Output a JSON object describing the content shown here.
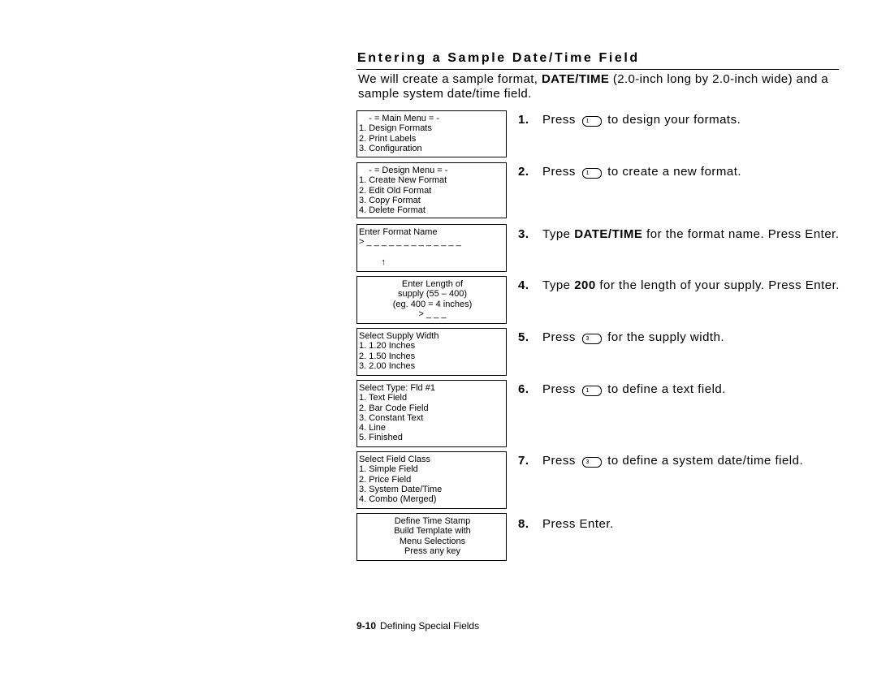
{
  "title": "Entering a Sample Date/Time Field",
  "intro": {
    "pre": "We will create a sample format, ",
    "bold": "DATE/TIME",
    "post": " (2.0-inch long by 2.0-inch wide) and a sample system date/time field."
  },
  "screens": [
    {
      "lines": [
        "    - = Main Menu = -",
        "1. Design Formats",
        "2. Print Labels",
        "3. Configuration"
      ]
    },
    {
      "lines": [
        "    - = Design Menu = -",
        "1. Create New Format",
        "2. Edit Old Format",
        "3. Copy Format",
        "4. Delete Format"
      ]
    },
    {
      "lines": [
        "Enter Format Name",
        "> _ _ _ _ _ _ _ _ _ _ _ _ _",
        "",
        "         ↑"
      ]
    },
    {
      "lines": [
        "Enter Length of",
        "supply (55 – 400)",
        "(eg. 400 = 4 inches)",
        "> _ _ _"
      ]
    },
    {
      "lines": [
        "Select Supply Width",
        "1. 1.20 Inches",
        "2. 1.50 Inches",
        "3. 2.00 Inches"
      ]
    },
    {
      "lines": [
        "Select Type: Fld #1",
        "1. Text Field",
        "2. Bar Code Field",
        "3. Constant Text",
        "4. Line",
        "5. Finished"
      ]
    },
    {
      "lines": [
        "Select Field Class",
        "1. Simple Field",
        "2. Price Field",
        "3. System Date/Time",
        "4. Combo (Merged)"
      ]
    },
    {
      "lines": [
        "Define Time Stamp",
        "Build Template with",
        "Menu Selections",
        "Press any key"
      ]
    }
  ],
  "steps": [
    {
      "num": "1.",
      "pre": "Press",
      "key": "1",
      "post": "to design your formats."
    },
    {
      "num": "2.",
      "pre": "Press",
      "key": "1",
      "post": "to create a new format."
    },
    {
      "num": "3.",
      "pre": "Type ",
      "bold": "DATE/TIME",
      "post": " for the format name.  Press Enter."
    },
    {
      "num": "4.",
      "pre": "Type ",
      "bold": "200",
      "post": " for the length of your supply.  Press Enter."
    },
    {
      "num": "5.",
      "pre": "Press",
      "key": "3",
      "post": "for the supply width."
    },
    {
      "num": "6.",
      "pre": "Press",
      "key": "1",
      "post": "to define a text field."
    },
    {
      "num": "7.",
      "pre": "Press",
      "key": "3",
      "post": "to define a system date/time field."
    },
    {
      "num": "8.",
      "pre": "Press Enter."
    }
  ],
  "footer": {
    "page": "9-10",
    "section": "Defining Special Fields"
  }
}
